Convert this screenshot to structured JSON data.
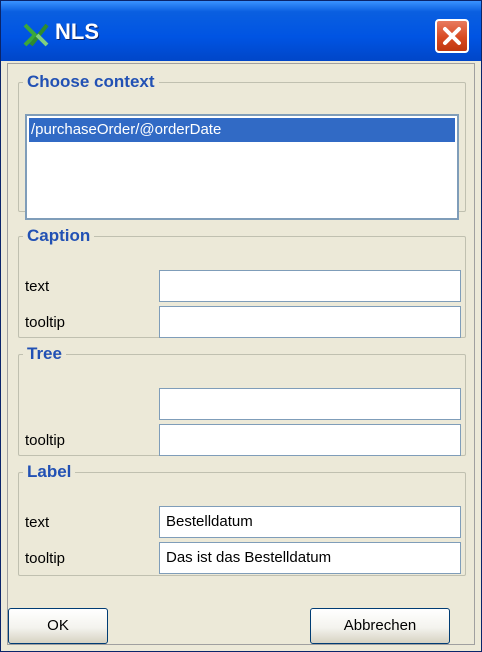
{
  "window": {
    "title": "NLS",
    "icon": "x-app-icon",
    "close_icon": "close-icon"
  },
  "context": {
    "legend": "Choose context",
    "items": [
      "/purchaseOrder/@orderDate"
    ],
    "selected": "/purchaseOrder/@orderDate"
  },
  "caption": {
    "legend": "Caption",
    "text_label": "text",
    "text_value": "",
    "tooltip_label": "tooltip",
    "tooltip_value": ""
  },
  "tree": {
    "legend": "Tree",
    "text_value": "",
    "tooltip_label": "tooltip",
    "tooltip_value": ""
  },
  "label": {
    "legend": "Label",
    "text_label": "text",
    "text_value": "Bestelldatum",
    "tooltip_label": "tooltip",
    "tooltip_value": "Das ist das Bestelldatum"
  },
  "buttons": {
    "ok": "OK",
    "cancel": "Abbrechen"
  },
  "colors": {
    "titlebar": "#0054e3",
    "selection": "#316ac5",
    "legend": "#2251b4",
    "close": "#d84a22"
  }
}
